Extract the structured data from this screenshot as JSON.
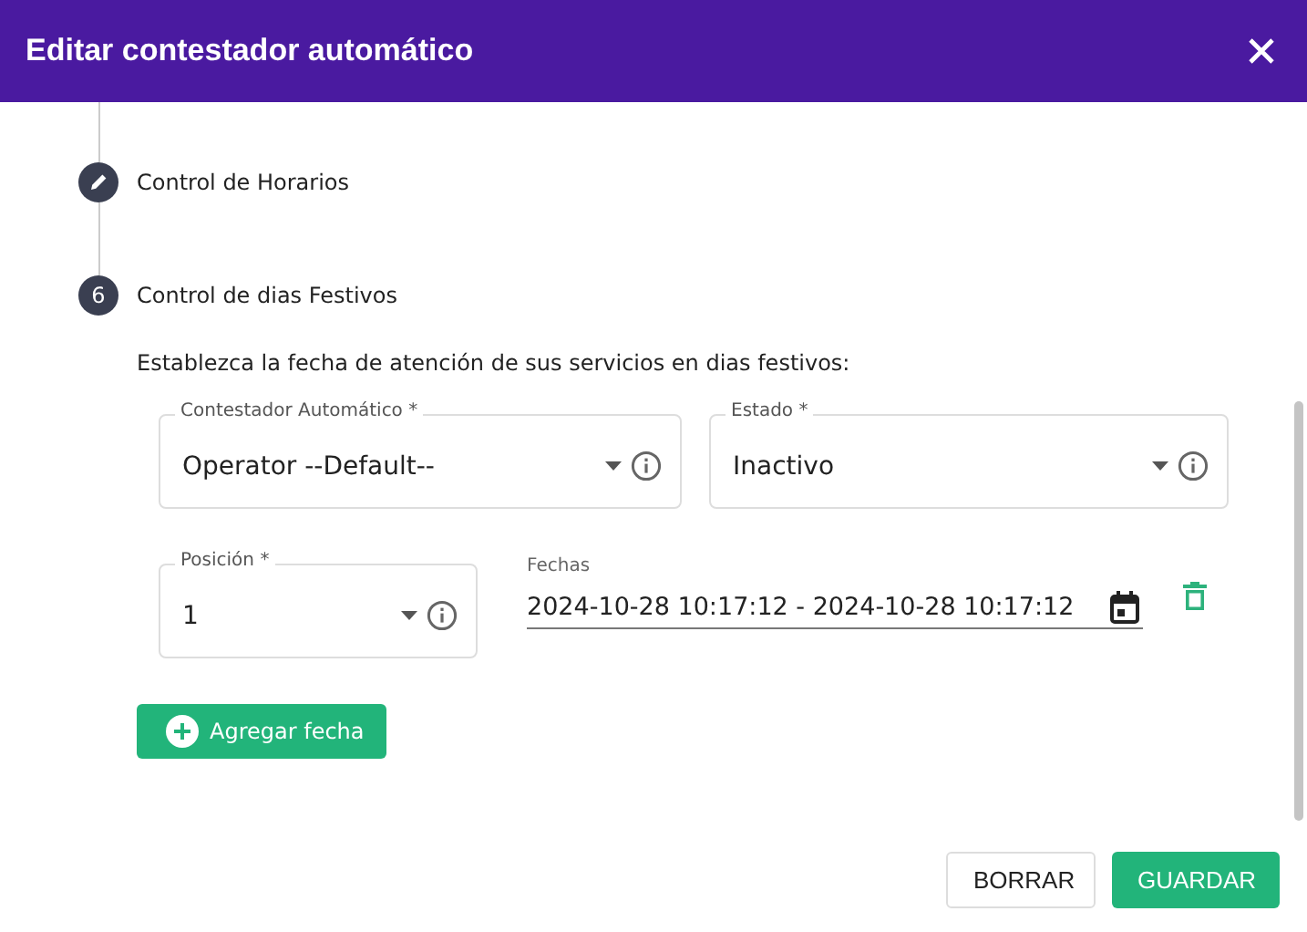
{
  "dialog": {
    "title": "Editar contestador automático"
  },
  "steps": [
    {
      "kind": "edit",
      "label": "Control de Horarios"
    },
    {
      "kind": "number",
      "number": "6",
      "label": "Control de dias Festivos"
    }
  ],
  "description": "Establezca la fecha de atención de sus servicios en dias festivos:",
  "rows": [
    [
      {
        "kind": "select",
        "label": "Contestador Automático *",
        "value": "Operator --Default--"
      },
      {
        "kind": "select",
        "label": "Estado *",
        "value": "Inactivo"
      }
    ],
    [
      {
        "kind": "select",
        "label": "Posición *",
        "value": "1"
      },
      {
        "kind": "date",
        "label": "Fechas",
        "value": "2024-10-28 10:17:12 - 2024-10-28 10:17:12"
      }
    ]
  ],
  "add_button": "Agregar fecha",
  "buttons": [
    {
      "kind": "secondary",
      "label": "BORRAR"
    },
    {
      "kind": "primary",
      "label": "GUARDAR"
    }
  ]
}
